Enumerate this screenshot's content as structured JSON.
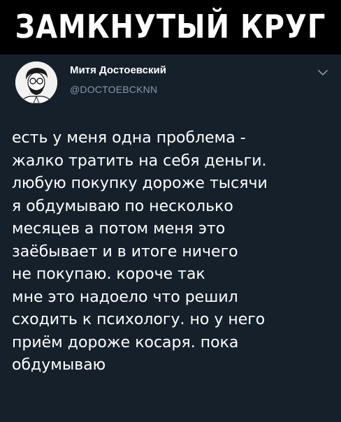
{
  "banner": {
    "title": "Замкнутый круг"
  },
  "tweet": {
    "author": {
      "display_name": "Митя Достоевский",
      "handle": "@DOCTOEBCKNN",
      "avatar_icon": "avatar-portrait-icon"
    },
    "menu_icon": "chevron-down-icon",
    "lines": [
      "есть у меня одна проблема -",
      "жалко тратить на себя деньги.",
      "любую покупку дороже тысячи",
      "я обдумываю по несколько",
      "месяцев а потом меня это",
      "заёбывает и в итоге ничего",
      "не покупаю. короче так",
      "мне это надоело что решил",
      "сходить к психологу. но у него",
      "приём дороже косаря. пока",
      "обдумываю"
    ]
  },
  "colors": {
    "banner_bg": "#000000",
    "tweet_bg": "#15202b",
    "text": "#ffffff",
    "secondary_text": "#8899a6"
  }
}
